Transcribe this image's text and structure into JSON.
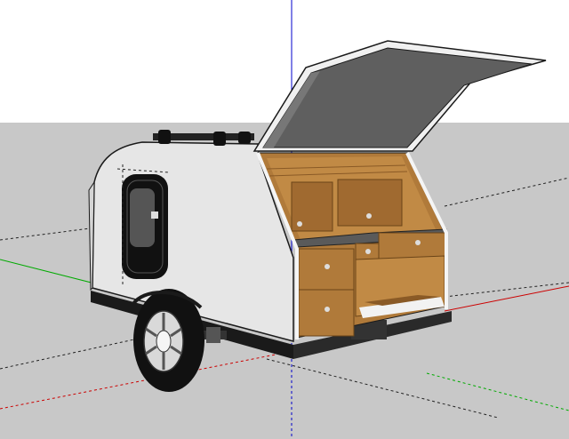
{
  "app": {
    "title": ""
  },
  "scene": {
    "model": "teardrop-trailer",
    "sky_color": "#ffffff",
    "ground_color": "#c8c8c8",
    "shell_color": "#e6e6e6",
    "shell_edge_color": "#1a1a1a",
    "wood_color": "#b07a3a",
    "wood_dark_color": "#8a5a26",
    "countertop_color": "#5a5a5a",
    "hatch_inner_color": "#5f5f5f",
    "tire_color": "#111111",
    "wheel_color": "#d9d9d9",
    "axis_colors": {
      "red": "#cc0000",
      "green": "#00aa00",
      "blue": "#0000cc"
    },
    "axes": [
      "red-axis",
      "green-axis",
      "blue-axis"
    ]
  }
}
